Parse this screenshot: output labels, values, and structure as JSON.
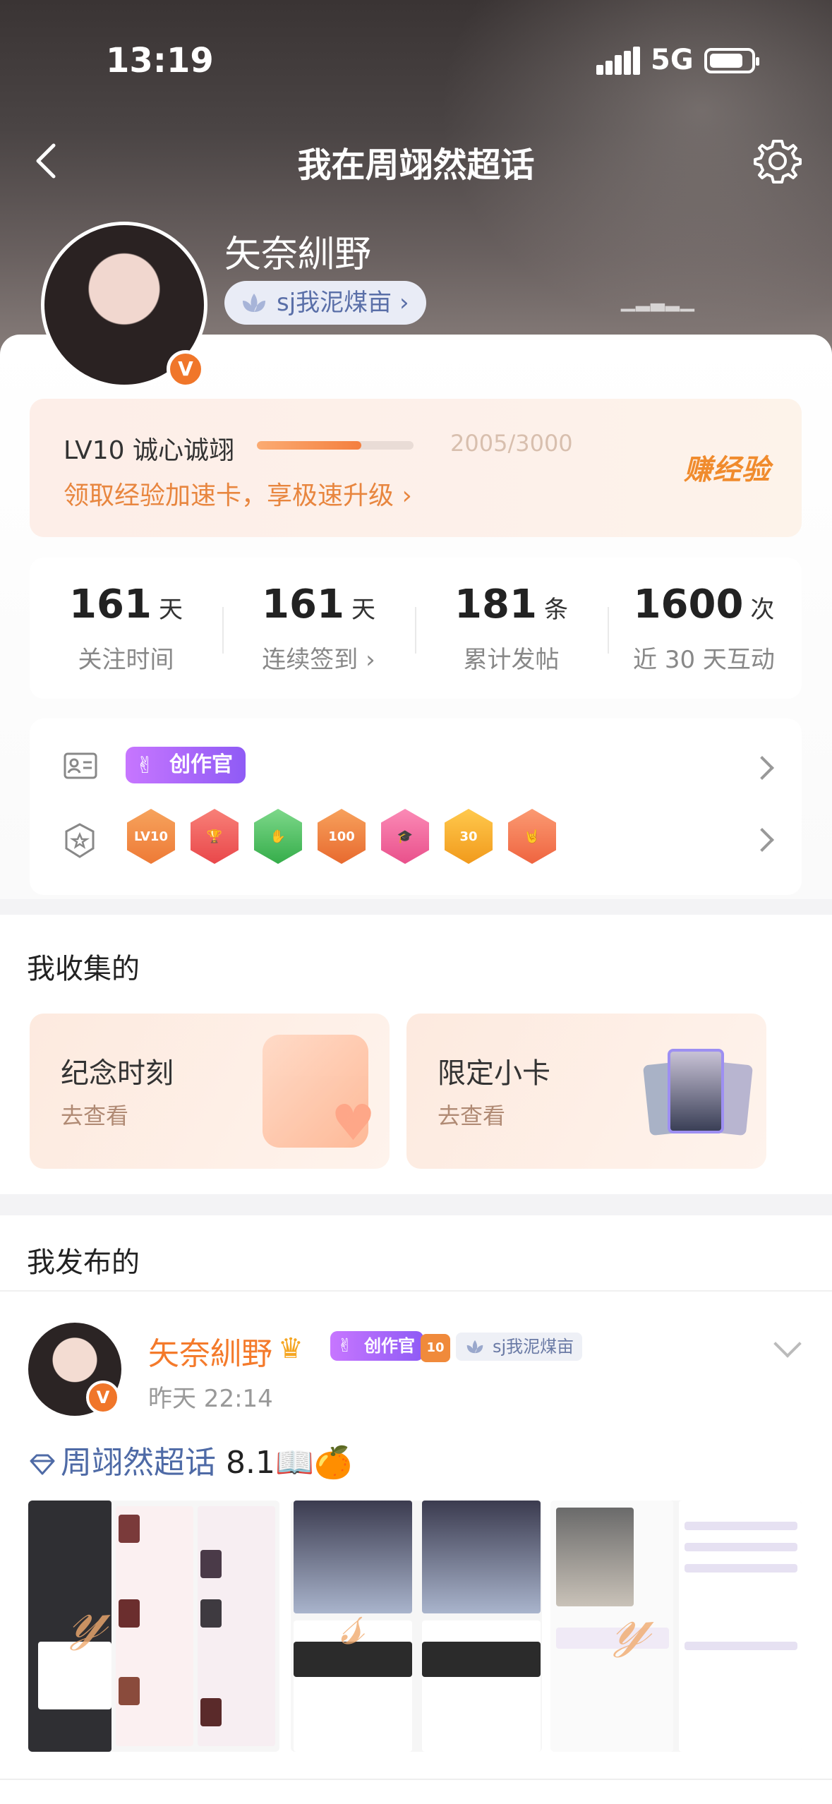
{
  "status_bar": {
    "time": "13:19",
    "network": "5G"
  },
  "nav": {
    "title": "我在周翊然超话"
  },
  "profile": {
    "name": "矢奈紃野",
    "tag": "sj我泥煤亩"
  },
  "level": {
    "title": "LV10 诚心诚翊",
    "exp": "2005/3000",
    "progress_fraction": 0.668,
    "link": "领取经验加速卡，享极速升级",
    "earn": "赚经验"
  },
  "stats": [
    {
      "num": "161",
      "unit": "天",
      "label": "关注时间"
    },
    {
      "num": "161",
      "unit": "天",
      "label": "连续签到"
    },
    {
      "num": "181",
      "unit": "条",
      "label": "累计发帖"
    },
    {
      "num": "1600",
      "unit": "次",
      "label": "近 30 天互动"
    }
  ],
  "badges": {
    "creator": "创作官",
    "medals": [
      "LV10",
      "trophy",
      "hand",
      "100",
      "cap",
      "30",
      "rock"
    ],
    "medal_labels": {
      "lv": "LV10",
      "hundred": "100",
      "thirty": "30"
    },
    "colors": [
      "#f08a3b",
      "#f2594f",
      "#4cbf5c",
      "#f0813a",
      "#f0679b",
      "#f5a623",
      "#f5714b"
    ]
  },
  "collect": {
    "title": "我收集的",
    "cards": [
      {
        "title": "纪念时刻",
        "sub": "去查看"
      },
      {
        "title": "限定小卡",
        "sub": "去查看"
      }
    ]
  },
  "posts": {
    "title": "我发布的",
    "item": {
      "name": "矢奈紃野",
      "creator": "创作官",
      "level": "10",
      "tag": "sj我泥煤亩",
      "time": "昨天 22:14",
      "topic": "周翊然超话",
      "text": " 8.1📖🍊"
    }
  },
  "colors": {
    "accent": "#f47a2b",
    "topic": "#4e6aa6",
    "badge_purple": "#a367f8"
  }
}
